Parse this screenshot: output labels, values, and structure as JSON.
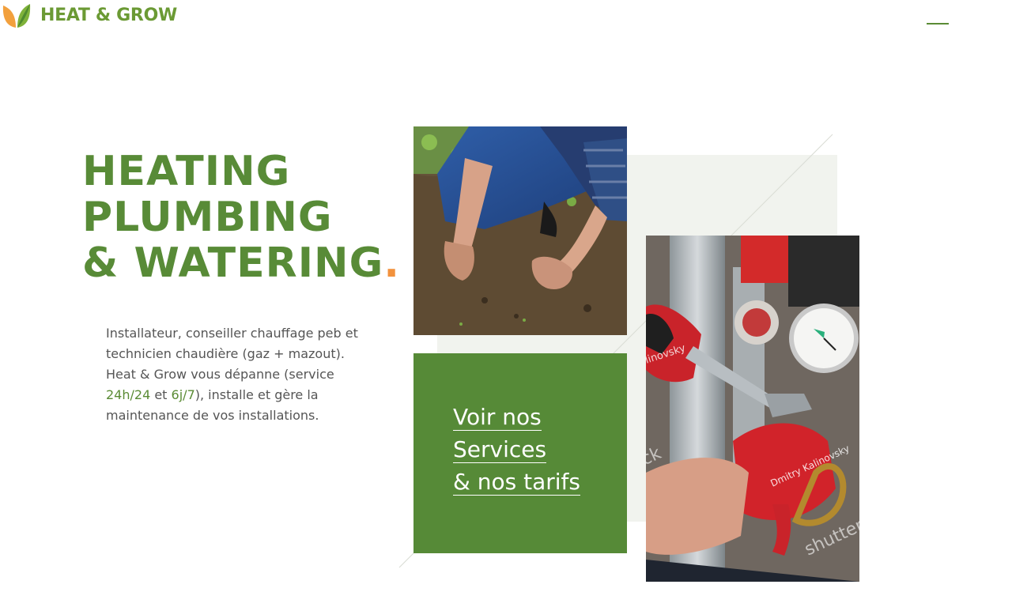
{
  "brand": {
    "name": "HEAT & GROW",
    "leaf_colors": [
      "#f2a03d",
      "#7fb23a",
      "#4f8a2e"
    ]
  },
  "header": {
    "menu_icon": "hamburger-menu-icon"
  },
  "hero": {
    "title_lines": [
      "HEATING",
      "PLUMBING",
      "& WATERING"
    ],
    "title_dot": ".",
    "intro": {
      "text_1": "Installateur, conseiller chauffage peb et technicien chaudière (gaz + mazout). Heat & Grow vous dépanne (service ",
      "highlight_1": "24h/24",
      "text_2": " et ",
      "highlight_2": "6j/7",
      "text_3": "), installe et gère la maintenance de vos installations."
    }
  },
  "cta": {
    "lines": [
      "Voir nos",
      "Services",
      "& nos tarifs"
    ]
  },
  "photos": {
    "soil_watermark": "",
    "heat_watermark_1": "alinovsky",
    "heat_watermark_2": "Dmitry Kalinovsky",
    "heat_watermark_3": "shutter",
    "heat_watermark_4": "ck"
  },
  "colors": {
    "primary_green": "#588b37",
    "accent_orange": "#f2923d",
    "cta_background": "#568a37",
    "panel_background": "#f1f3ee"
  }
}
